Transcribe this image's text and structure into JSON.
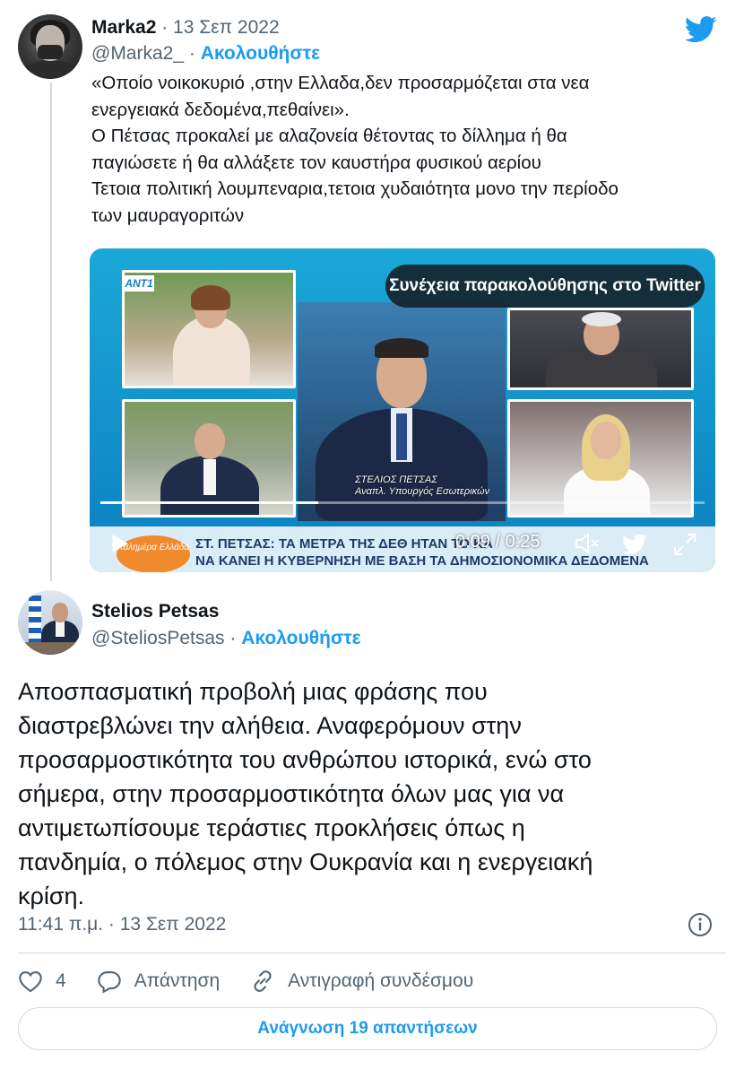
{
  "colors": {
    "accent": "#1d9bf0",
    "text": "#0f1419",
    "muted": "#536471",
    "border": "#cfd9de"
  },
  "quoted_tweet": {
    "author_name": "Marka2",
    "date": "· 13 Σεπ 2022",
    "handle": "@Marka2_",
    "separator": "·",
    "follow_label": "Ακολουθήστε",
    "text_lines": [
      "«Οποίο νοικοκυριό ,στην Ελλαδα,δεν προσαρμόζεται στα νεα",
      "ενεργειακά δεδομένα,πεθαίνει».",
      "Ο Πέτσας προκαλεί με αλαζονεία θέτοντας το δίλλημα ή θα",
      "παγιώσετε ή θα αλλάξετε τον καυστήρα φυσικού αερίου",
      "Τετοια πολιτική λουμπεναρια,τετοια χυδαιότητα μονο την περίοδο",
      "των μαυραγοριτών"
    ],
    "video": {
      "banner": "Συνέχεια παρακολούθησης στο Twitter",
      "elapsed": "0:09",
      "duration": "0:25",
      "time_display": "0:09 / 0:25",
      "progress": 0.36,
      "channel_logo": "ANT1",
      "show_logo": "Καλημέρα Ελλάδα",
      "caption_name": "ΣΤΕΛΙΟΣ ΠΕΤΣΑΣ",
      "caption_role": "Αναπλ. Υπουργός Εσωτερικών",
      "ticker_line1": "ΣΤ. ΠΕΤΣΑΣ: ΤΑ ΜΕΤΡΑ ΤΗΣ ΔΕΘ ΗΤΑΝ ΤΟ ΚΑ",
      "ticker_line2": "ΝΑ ΚΑΝΕΙ Η ΚΥΒΕΡΝΗΣΗ ΜΕ ΒΑΣΗ ΤΑ ΔΗΜΟΣΙΟΝΟΜΙΚΑ ΔΕΔΟΜΕΝΑ"
    }
  },
  "main_tweet": {
    "author_name": "Stelios Petsas",
    "handle": "@SteliosPetsas",
    "separator": "·",
    "follow_label": "Ακολουθήστε",
    "text_lines": [
      "Αποσπασματική προβολή μιας φράσης που",
      "διαστρεβλώνει την αλήθεια. Αναφερόμουν στην",
      "προσαρμοστικότητα του ανθρώπου ιστορικά, ενώ στο",
      "σήμερα, στην προσαρμοστικότητα όλων μας για να",
      "αντιμετωπίσουμε τεράστιες προκλήσεις όπως η",
      "πανδημία, ο πόλεμος στην Ουκρανία και η ενεργειακή",
      "κρίση."
    ],
    "timestamp": "11:41 π.μ. · 13 Σεπ 2022",
    "like_count": "4",
    "reply_label": "Απάντηση",
    "copy_link_label": "Αντιγραφή συνδέσμου",
    "read_replies_label": "Ανάγνωση 19 απαντήσεων"
  },
  "icons": [
    "twitter-bird-icon",
    "play-icon",
    "volume-icon",
    "expand-icon",
    "info-icon",
    "heart-icon",
    "reply-icon",
    "link-icon"
  ]
}
